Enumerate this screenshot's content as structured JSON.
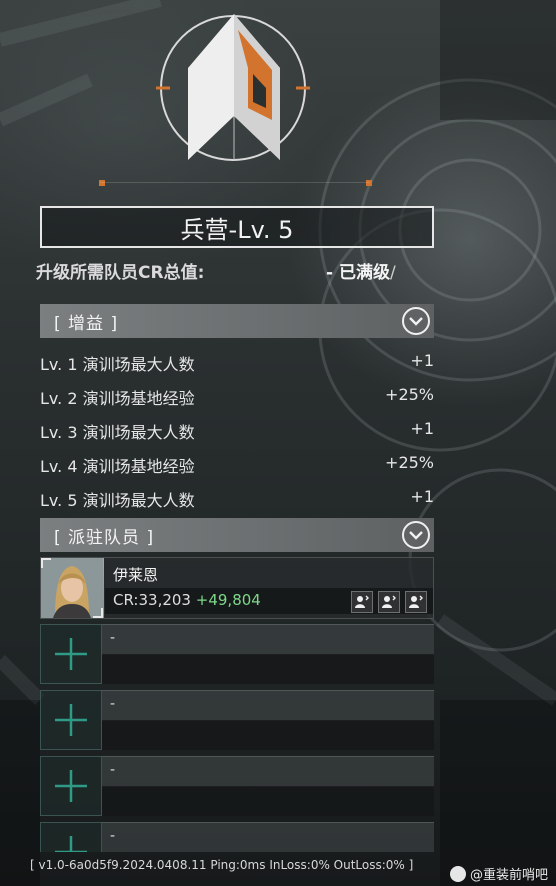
{
  "building": {
    "title": "兵营-Lv. 5",
    "requirement_label": "升级所需队员CR总值:",
    "requirement_value": "- 已满级",
    "requirement_sep": "/"
  },
  "bonus_section": {
    "label": "[ 增益 ]",
    "rows": [
      {
        "level": "Lv. 1 演训场最大人数",
        "value": "+1"
      },
      {
        "level": "Lv. 2 演训场基地经验",
        "value": "+25%"
      },
      {
        "level": "Lv. 3 演训场最大人数",
        "value": "+1"
      },
      {
        "level": "Lv. 4 演训场基地经验",
        "value": "+25%"
      },
      {
        "level": "Lv. 5 演训场最大人数",
        "value": "+1"
      }
    ]
  },
  "staff_section": {
    "label": "[ 派驻队员 ]",
    "member": {
      "name": "伊莱恩",
      "cr": "CR:33,203",
      "cr_bonus": "+49,804",
      "skill_icons": [
        "member-skill-icon",
        "member-skill-icon",
        "member-skill-icon"
      ]
    },
    "empty_slots": [
      "-",
      "-",
      "-",
      "-"
    ]
  },
  "footer": {
    "version": "[ v1.0-6a0d5f9.2024.0408.11   Ping:0ms   InLoss:0%   OutLoss:0% ]",
    "watermark": "@重装前哨吧"
  },
  "colors": {
    "accent_orange": "#d2732e",
    "bonus_green": "#7fd88a",
    "add_cross": "#2f9a86"
  }
}
